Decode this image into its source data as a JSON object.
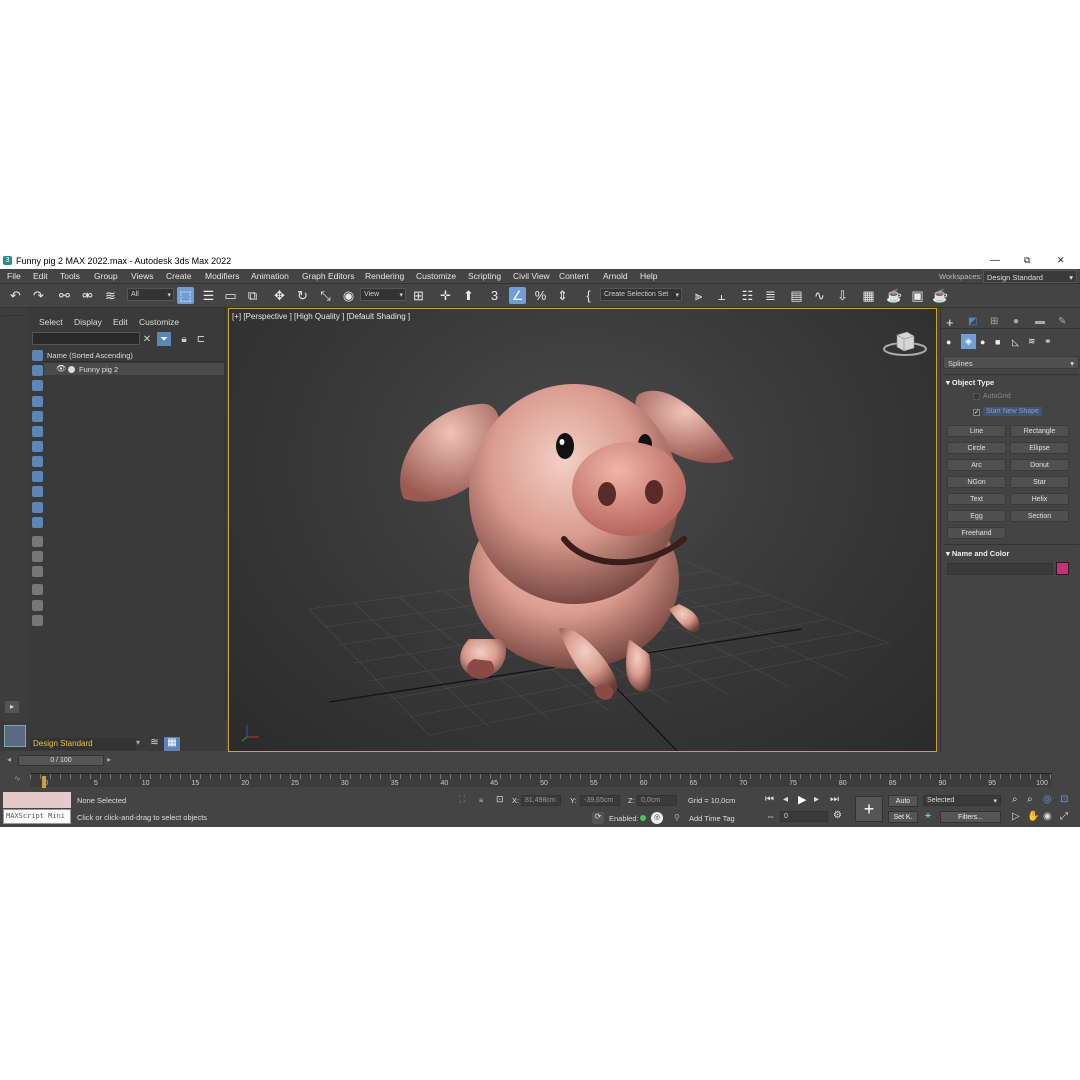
{
  "window": {
    "title": "Funny pig 2 MAX 2022.max - Autodesk 3ds Max 2022",
    "app_icon": "3",
    "minimize": "—",
    "maximize": "⧉",
    "close": "✕"
  },
  "menu": {
    "items": [
      "File",
      "Edit",
      "Tools",
      "Group",
      "Views",
      "Create",
      "Modifiers",
      "Animation",
      "Graph Editors",
      "Rendering",
      "Customize",
      "Scripting",
      "Civil View",
      "Content",
      "Arnold",
      "Help"
    ],
    "workspaces_label": "Workspaces:",
    "workspace_value": "Design Standard"
  },
  "toolbar": {
    "filter_dropdown": "All",
    "view_dropdown": "View",
    "selection_set_dropdown": "Create Selection Set"
  },
  "scene_explorer": {
    "tabs": [
      "Select",
      "Display",
      "Edit",
      "Customize"
    ],
    "column_header": "Name (Sorted Ascending)",
    "rows": [
      "Funny pig 2"
    ]
  },
  "workspace_selector": "Design Standard",
  "viewport": {
    "label": "[+] [Perspective ] [High Quality ] [Default Shading ]"
  },
  "command_panel": {
    "category_dropdown": "Splines",
    "object_type_title": "Object Type",
    "autogrid_label": "AutoGrid",
    "start_new_shape_label": "Start New Shape",
    "shape_buttons": [
      "Line",
      "Rectangle",
      "Circle",
      "Ellipse",
      "Arc",
      "Donut",
      "NGon",
      "Star",
      "Text",
      "Helix",
      "Egg",
      "Section",
      "Freehand"
    ],
    "name_and_color_title": "Name and Color",
    "object_color": "#c8307a"
  },
  "timeline": {
    "frame_display": "0 / 100",
    "ticks": [
      "0",
      "5",
      "10",
      "15",
      "20",
      "25",
      "30",
      "35",
      "40",
      "45",
      "50",
      "55",
      "60",
      "65",
      "70",
      "75",
      "80",
      "85",
      "90",
      "95",
      "100"
    ],
    "current_frame_fraction": 0
  },
  "status": {
    "maxscript_label": "MAXScript Mini",
    "selection_status": "None Selected",
    "prompt": "Click or click-and-drag to select objects",
    "x_label": "X:",
    "x_value": "81,498cm",
    "y_label": "Y:",
    "y_value": "-39,65cm",
    "z_label": "Z:",
    "z_value": "0,0cm",
    "grid": "Grid = 10,0cm",
    "enabled_label": "Enabled:",
    "add_time_tag": "Add Time Tag",
    "auto_button": "Auto",
    "set_key_button": "Set K.",
    "selected_dropdown": "Selected",
    "filters_button": "Filters...",
    "frame_spinner": "0"
  },
  "colors": {
    "accent_blue": "#6f9fd8",
    "viewport_border": "#c8a23a",
    "workspace_text": "#e8c23c"
  }
}
